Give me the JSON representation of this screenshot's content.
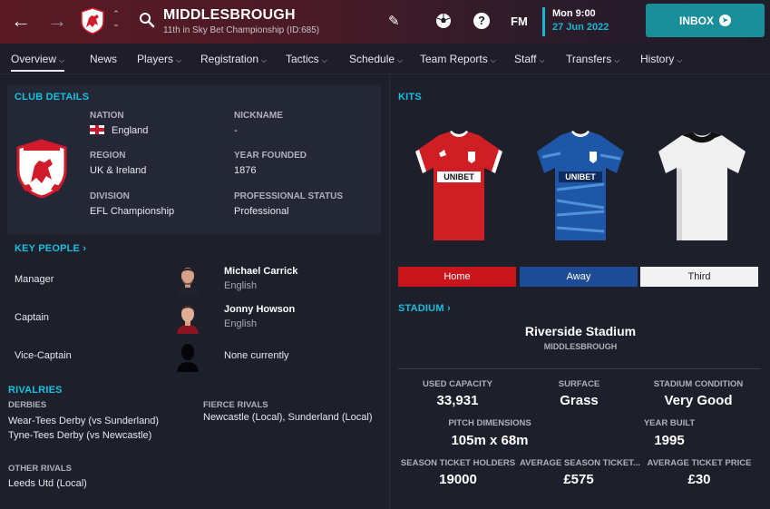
{
  "header": {
    "club_name": "MIDDLESBROUGH",
    "club_subtitle": "11th in Sky Bet Championship (ID:685)",
    "fm_label": "FM",
    "help_label": "?",
    "date_day": "Mon 9:00",
    "date_full": "27 Jun 2022",
    "inbox_label": "INBOX"
  },
  "tabs": [
    {
      "label": "Overview"
    },
    {
      "label": "News"
    },
    {
      "label": "Players"
    },
    {
      "label": "Registration"
    },
    {
      "label": "Tactics"
    },
    {
      "label": "Schedule"
    },
    {
      "label": "Team Reports"
    },
    {
      "label": "Staff"
    },
    {
      "label": "Transfers"
    },
    {
      "label": "History"
    }
  ],
  "club_details": {
    "title": "CLUB DETAILS",
    "nation_label": "NATION",
    "nation": "England",
    "nickname_label": "NICKNAME",
    "nickname": "-",
    "region_label": "REGION",
    "region": "UK & Ireland",
    "year_founded_label": "YEAR FOUNDED",
    "year_founded": "1876",
    "division_label": "DIVISION",
    "division": "EFL Championship",
    "status_label": "PROFESSIONAL STATUS",
    "status": "Professional"
  },
  "key_people": {
    "title": "KEY PEOPLE",
    "manager_label": "Manager",
    "manager_name": "Michael Carrick",
    "manager_nat": "English",
    "captain_label": "Captain",
    "captain_name": "Jonny Howson",
    "captain_nat": "English",
    "vice_label": "Vice-Captain",
    "vice_value": "None currently"
  },
  "rivalries": {
    "title": "RIVALRIES",
    "derbies_label": "DERBIES",
    "derby_1": "Wear-Tees Derby (vs Sunderland)",
    "derby_2": "Tyne-Tees Derby (vs Newcastle)",
    "fierce_label": "FIERCE RIVALS",
    "fierce": "Newcastle (Local), Sunderland (Local)",
    "other_label": "OTHER RIVALS",
    "other": "Leeds Utd (Local)"
  },
  "kits": {
    "title": "KITS",
    "sponsor": "UNIBET",
    "home_label": "Home",
    "away_label": "Away",
    "third_label": "Third"
  },
  "stadium": {
    "title": "STADIUM",
    "name": "Riverside Stadium",
    "city": "MIDDLESBROUGH",
    "used_capacity_label": "USED CAPACITY",
    "used_capacity": "33,931",
    "surface_label": "SURFACE",
    "surface": "Grass",
    "condition_label": "STADIUM CONDITION",
    "condition": "Very Good",
    "pitch_label": "PITCH DIMENSIONS",
    "pitch": "105m x 68m",
    "year_built_label": "YEAR BUILT",
    "year_built": "1995",
    "season_holders_label": "SEASON TICKET HOLDERS",
    "season_holders": "19000",
    "avg_season_label": "AVERAGE SEASON TICKET...",
    "avg_season": "£575",
    "avg_ticket_label": "AVERAGE TICKET PRICE",
    "avg_ticket": "£30"
  },
  "colors": {
    "accent": "#16c0e0",
    "home_kit": "#c8151b",
    "away_kit": "#1d4b95",
    "inbox": "#1a8f9a"
  }
}
